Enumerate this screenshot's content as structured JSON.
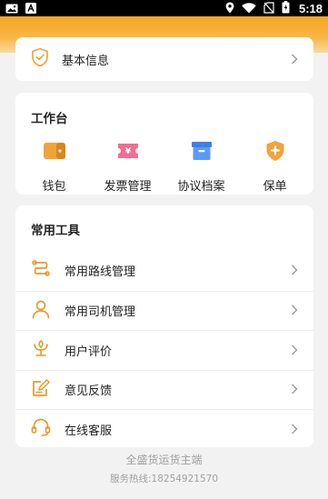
{
  "status_bar": {
    "time": "5:18",
    "icons": [
      "gallery-icon",
      "app-icon",
      "location-icon",
      "wifi-icon",
      "no-sim-icon",
      "battery-icon"
    ]
  },
  "colors": {
    "accent": "#f5a623",
    "icon_orange": "#f2a33a",
    "icon_pink": "#f56c8e",
    "icon_blue": "#4a8ff2",
    "text": "#222222",
    "muted": "#a0a0a0"
  },
  "basic_info": {
    "label": "基本信息",
    "icon": "shield-check-icon"
  },
  "workbench": {
    "title": "工作台",
    "items": [
      {
        "label": "钱包",
        "icon": "wallet-icon"
      },
      {
        "label": "发票管理",
        "icon": "invoice-icon"
      },
      {
        "label": "协议档案",
        "icon": "archive-icon"
      },
      {
        "label": "保单",
        "icon": "insurance-icon"
      }
    ]
  },
  "tools": {
    "title": "常用工具",
    "items": [
      {
        "label": "常用路线管理",
        "icon": "route-icon"
      },
      {
        "label": "常用司机管理",
        "icon": "driver-icon"
      },
      {
        "label": "用户评价",
        "icon": "rating-icon"
      },
      {
        "label": "意见反馈",
        "icon": "feedback-icon"
      },
      {
        "label": "在线客服",
        "icon": "headset-icon"
      }
    ]
  },
  "footer": {
    "title": "全盛货运货主端",
    "hotline": "服务热线:18254921570"
  }
}
